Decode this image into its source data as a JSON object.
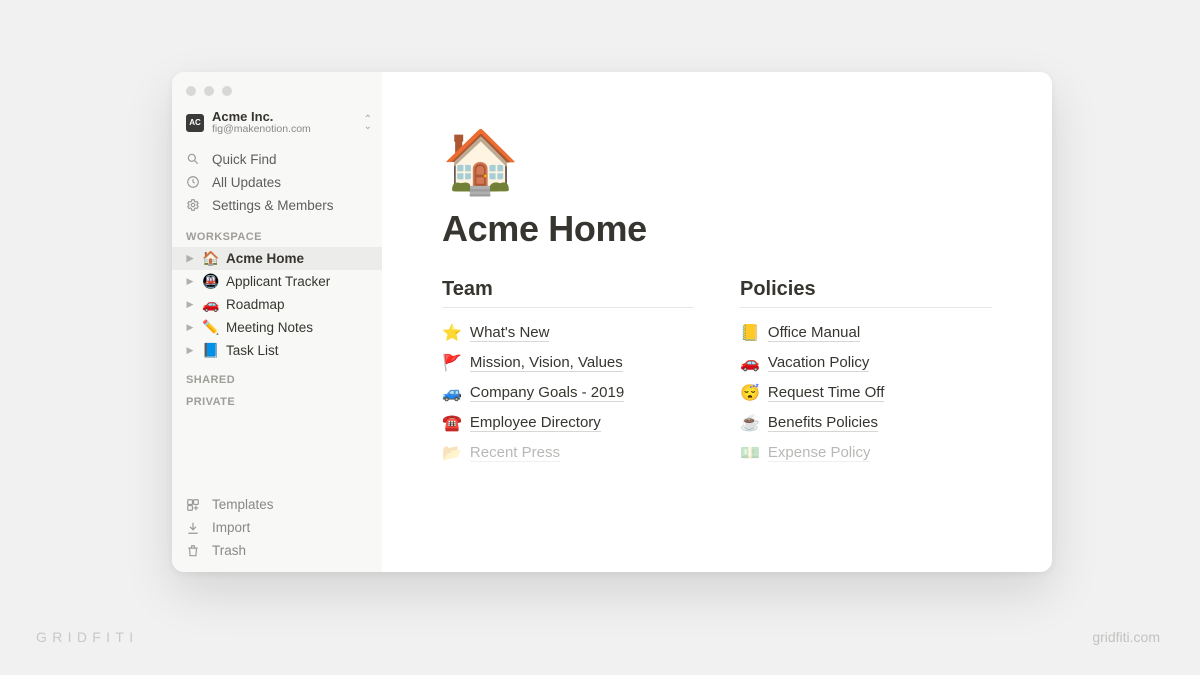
{
  "workspace": {
    "name": "Acme Inc.",
    "email": "fig@makenotion.com"
  },
  "sidebar": {
    "quick_find": "Quick Find",
    "all_updates": "All Updates",
    "settings": "Settings & Members",
    "section_workspace": "WORKSPACE",
    "section_shared": "SHARED",
    "section_private": "PRIVATE",
    "pages": [
      {
        "emoji": "🏠",
        "label": "Acme Home",
        "active": true
      },
      {
        "emoji": "🚇",
        "label": "Applicant Tracker",
        "active": false
      },
      {
        "emoji": "🚗",
        "label": "Roadmap",
        "active": false
      },
      {
        "emoji": "✏️",
        "label": "Meeting Notes",
        "active": false
      },
      {
        "emoji": "📘",
        "label": "Task List",
        "active": false
      }
    ],
    "templates": "Templates",
    "import": "Import",
    "trash": "Trash"
  },
  "page": {
    "hero_emoji": "🏠",
    "title": "Acme Home",
    "columns": [
      {
        "heading": "Team",
        "links": [
          {
            "emoji": "⭐",
            "label": "What's New"
          },
          {
            "emoji": "🚩",
            "label": "Mission, Vision, Values"
          },
          {
            "emoji": "🚙",
            "label": "Company Goals - 2019"
          },
          {
            "emoji": "☎️",
            "label": "Employee Directory"
          },
          {
            "emoji": "📂",
            "label": "Recent Press"
          }
        ]
      },
      {
        "heading": "Policies",
        "links": [
          {
            "emoji": "📒",
            "label": "Office Manual"
          },
          {
            "emoji": "🚗",
            "label": "Vacation Policy"
          },
          {
            "emoji": "😴",
            "label": "Request Time Off"
          },
          {
            "emoji": "☕",
            "label": "Benefits Policies"
          },
          {
            "emoji": "💵",
            "label": "Expense Policy"
          }
        ]
      }
    ]
  },
  "footer": {
    "brand": "GRIDFITI",
    "url": "gridfiti.com"
  }
}
